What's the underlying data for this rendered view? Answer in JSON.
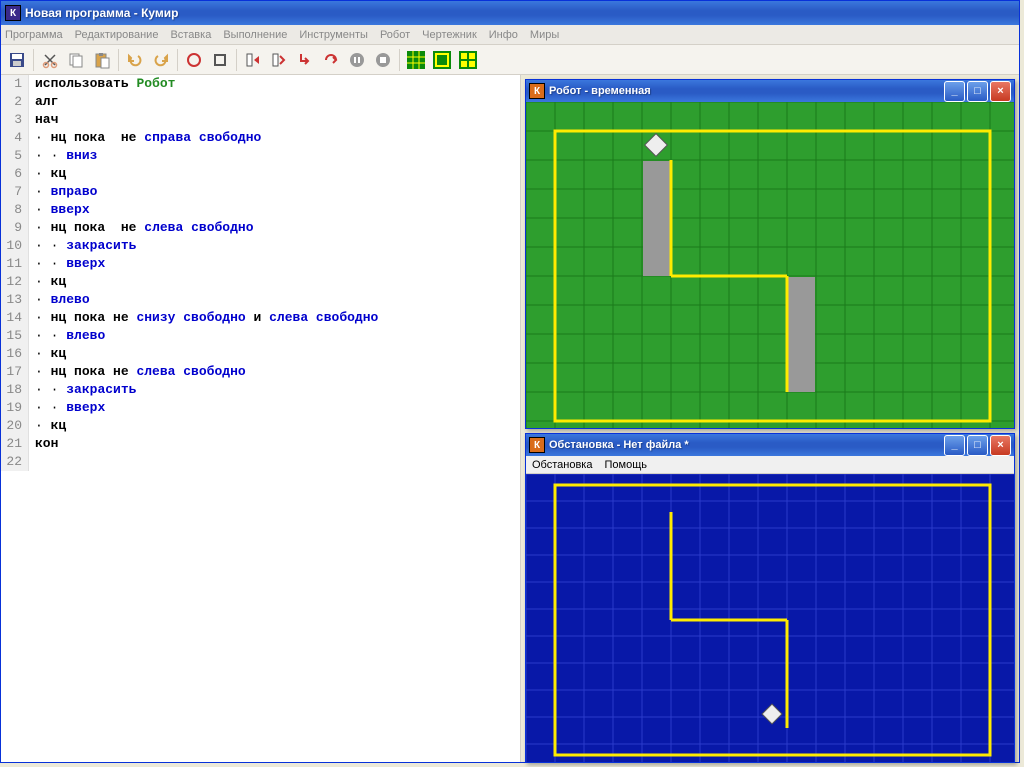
{
  "window": {
    "title": "Новая программа - Кумир",
    "icon": "К"
  },
  "menu": [
    "Программа",
    "Редактирование",
    "Вставка",
    "Выполнение",
    "Инструменты",
    "Робот",
    "Чертежник",
    "Инфо",
    "Миры"
  ],
  "code": [
    {
      "n": 1,
      "html": "<span class='kw-plain'>использовать</span> <span class='fn'>Робот</span>"
    },
    {
      "n": 2,
      "html": "<span class='kw-plain'>алг</span>"
    },
    {
      "n": 3,
      "html": "<span class='kw-plain'>нач</span>"
    },
    {
      "n": 4,
      "html": "<span class='dot'>·</span> <span class='kw-plain'>нц пока </span> <span class='kw-plain'>не</span> <span class='kw'>справа свободно</span>"
    },
    {
      "n": 5,
      "html": "<span class='dot'>·</span> <span class='dot'>·</span> <span class='kw'>вниз</span>"
    },
    {
      "n": 6,
      "html": "<span class='dot'>·</span> <span class='kw-plain'>кц</span>"
    },
    {
      "n": 7,
      "html": "<span class='dot'>·</span> <span class='kw'>вправо</span>"
    },
    {
      "n": 8,
      "html": "<span class='dot'>·</span> <span class='kw'>вверх</span>"
    },
    {
      "n": 9,
      "html": "<span class='dot'>·</span> <span class='kw-plain'>нц пока </span> <span class='kw-plain'>не</span> <span class='kw'>слева свободно</span>"
    },
    {
      "n": 10,
      "html": "<span class='dot'>·</span> <span class='dot'>·</span> <span class='kw'>закрасить</span>"
    },
    {
      "n": 11,
      "html": "<span class='dot'>·</span> <span class='dot'>·</span> <span class='kw'>вверх</span>"
    },
    {
      "n": 12,
      "html": "<span class='dot'>·</span> <span class='kw-plain'>кц</span>"
    },
    {
      "n": 13,
      "html": "<span class='dot'>·</span> <span class='kw'>влево</span>"
    },
    {
      "n": 14,
      "html": "<span class='dot'>·</span> <span class='kw-plain'>нц пока не</span> <span class='kw'>снизу свободно</span> <span class='kw-plain'>и</span> <span class='kw'>слева свободно</span>"
    },
    {
      "n": 15,
      "html": "<span class='dot'>·</span> <span class='dot'>·</span> <span class='kw'>влево</span>"
    },
    {
      "n": 16,
      "html": "<span class='dot'>·</span> <span class='kw-plain'>кц</span>"
    },
    {
      "n": 17,
      "html": "<span class='dot'>·</span> <span class='kw-plain'>нц пока не</span> <span class='kw'>слева свободно</span>"
    },
    {
      "n": 18,
      "html": "<span class='dot'>·</span> <span class='dot'>·</span> <span class='kw'>закрасить</span>"
    },
    {
      "n": 19,
      "html": "<span class='dot'>·</span> <span class='dot'>·</span> <span class='kw'>вверх</span>"
    },
    {
      "n": 20,
      "html": "<span class='dot'>·</span> <span class='kw-plain'>кц</span>"
    },
    {
      "n": 21,
      "html": "<span class='kw-plain'>кон</span>"
    },
    {
      "n": 22,
      "html": ""
    }
  ],
  "robot_window": {
    "title": "Робот - временная"
  },
  "env_window": {
    "title": "Обстановка - Нет файла *",
    "menu": [
      "Обстановка",
      "Помощь"
    ]
  }
}
